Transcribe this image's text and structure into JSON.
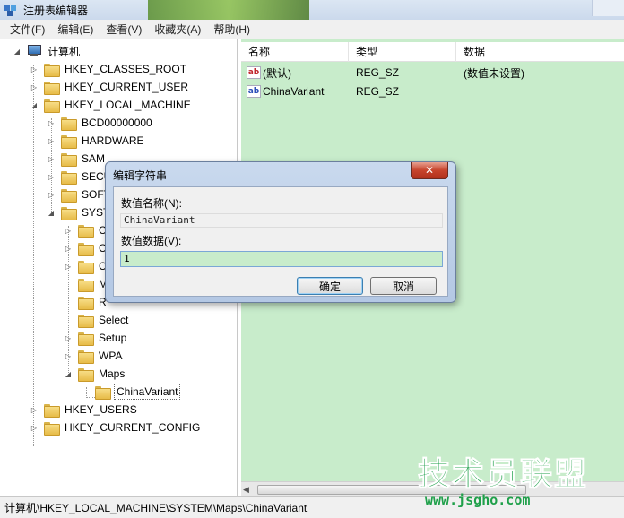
{
  "window": {
    "title": "注册表编辑器"
  },
  "menu": [
    "文件(F)",
    "编辑(E)",
    "查看(V)",
    "收藏夹(A)",
    "帮助(H)"
  ],
  "tree": {
    "root": "计算机",
    "items": [
      {
        "label": "HKEY_CLASSES_ROOT"
      },
      {
        "label": "HKEY_CURRENT_USER"
      },
      {
        "label": "HKEY_LOCAL_MACHINE"
      },
      {
        "label": "BCD00000000"
      },
      {
        "label": "HARDWARE"
      },
      {
        "label": "SAM"
      },
      {
        "label": "SECU"
      },
      {
        "label": "SOFT"
      },
      {
        "label": "SYST"
      },
      {
        "label": "Co"
      },
      {
        "label": "Co"
      },
      {
        "label": "Co"
      },
      {
        "label": "M"
      },
      {
        "label": "R"
      },
      {
        "label": "Select"
      },
      {
        "label": "Setup"
      },
      {
        "label": "WPA"
      },
      {
        "label": "Maps"
      },
      {
        "label": "ChinaVariant"
      },
      {
        "label": "HKEY_USERS"
      },
      {
        "label": "HKEY_CURRENT_CONFIG"
      }
    ]
  },
  "list": {
    "columns": [
      "名称",
      "类型",
      "数据"
    ],
    "rows": [
      {
        "icon": "string-value-icon",
        "name": "(默认)",
        "type": "REG_SZ",
        "data": "(数值未设置)"
      },
      {
        "icon": "string-value-icon",
        "name": "ChinaVariant",
        "type": "REG_SZ",
        "data": ""
      }
    ]
  },
  "status": {
    "path": "计算机\\HKEY_LOCAL_MACHINE\\SYSTEM\\Maps\\ChinaVariant"
  },
  "dialog": {
    "title": "编辑字符串",
    "close": "✕",
    "name_label": "数值名称(N):",
    "name_value": "ChinaVariant",
    "data_label": "数值数据(V):",
    "data_value": "1",
    "ok": "确定",
    "cancel": "取消"
  },
  "watermark": {
    "main": "技术员联盟",
    "sub": "www.jsgho.com"
  },
  "colors": {
    "list_bg": "#c8eccb",
    "watermark": "#1fa04a",
    "close_button": "#c7442c"
  }
}
